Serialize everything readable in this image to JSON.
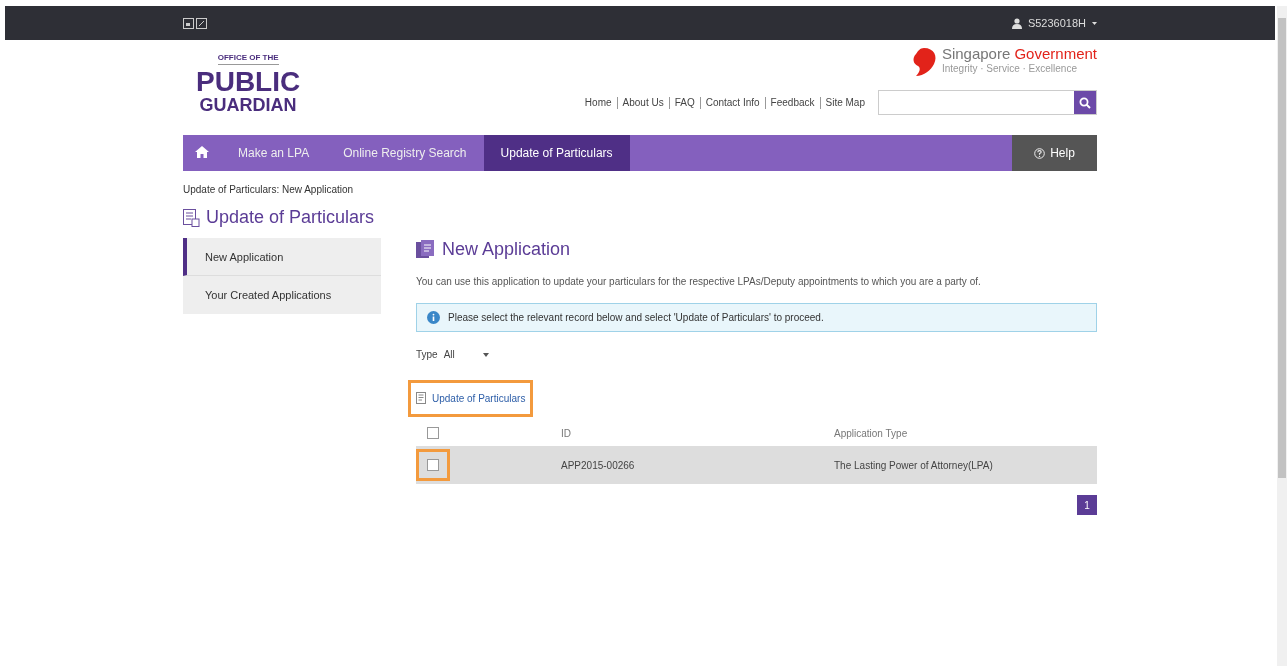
{
  "top_bar": {
    "user": "S5236018H"
  },
  "logo": {
    "line_1": "OFFICE OF THE",
    "line_2": "PUBLIC",
    "line_3": "GUARDIAN"
  },
  "government": {
    "name_1": "Singapore",
    "name_2": "Government",
    "motto": "Integrity · Service · Excellence"
  },
  "header_links": [
    "Home",
    "About Us",
    "FAQ",
    "Contact Info",
    "Feedback",
    "Site Map"
  ],
  "nav": {
    "items": [
      {
        "label": "Make an LPA",
        "selected": false
      },
      {
        "label": "Online Registry Search",
        "selected": false
      },
      {
        "label": "Update of Particulars",
        "selected": true
      }
    ],
    "help": "Help"
  },
  "breadcrumb": "Update of Particulars: New Application",
  "page_title": "Update of Particulars",
  "sidebar": {
    "items": [
      {
        "label": "New Application",
        "selected": true
      },
      {
        "label": "Your Created Applications",
        "selected": false
      }
    ]
  },
  "content": {
    "heading": "New Application",
    "intro": "You can use this application to update your particulars for the respective LPAs/Deputy appointments to which you are a party of.",
    "info": "Please select the relevant record below and select 'Update of Particulars' to proceed.",
    "filter": {
      "label": "Type",
      "value": "All"
    },
    "action": {
      "label": "Update of Particulars",
      "highlighted": true
    },
    "table": {
      "header_checked": false,
      "columns": [
        "ID",
        "Application Type"
      ],
      "rows": [
        {
          "checked": false,
          "highlighted": true,
          "id": "APP2015-00266",
          "type": "The Lasting Power of Attorney(LPA)"
        }
      ]
    },
    "pages": [
      {
        "label": "1",
        "selected": true
      }
    ]
  }
}
